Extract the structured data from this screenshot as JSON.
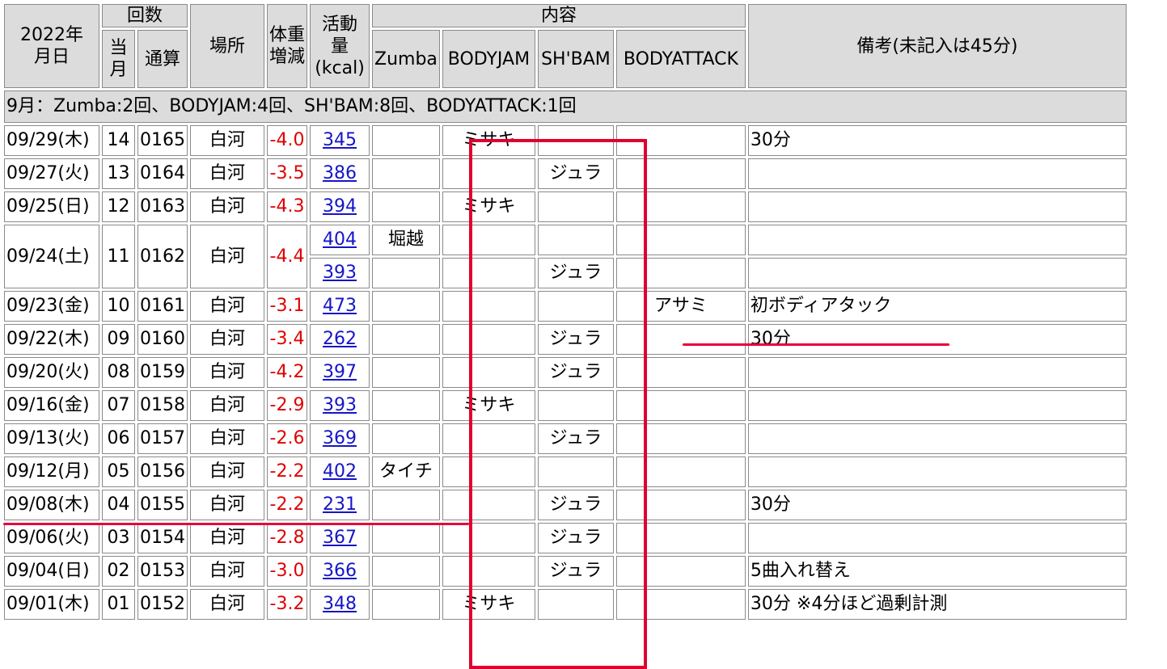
{
  "header": {
    "date_label": "2022年\n月日",
    "count_group": "回数",
    "count_month": "当\n月",
    "count_total": "通算",
    "place": "場所",
    "weight": "体重\n増減",
    "activity": "活動\n量\n(kcal)",
    "content_group": "内容",
    "programs": [
      "Zumba",
      "BODYJAM",
      "SH'BAM",
      "BODYATTACK"
    ],
    "notes": "備考(未記入は45分)"
  },
  "summary": "9月：Zumba:2回、BODYJAM:4回、SH'BAM:8回、BODYATTACK:1回",
  "rows": [
    {
      "date": "09/29(木)",
      "month": "14",
      "total": "0165",
      "place": "白河",
      "weight": "-4.0",
      "kcal": "345",
      "zumba": "",
      "bodyjam": "ミサキ",
      "shbam": "",
      "attack": "",
      "note": "30分"
    },
    {
      "date": "09/27(火)",
      "month": "13",
      "total": "0164",
      "place": "白河",
      "weight": "-3.5",
      "kcal": "386",
      "zumba": "",
      "bodyjam": "",
      "shbam": "ジュラ",
      "attack": "",
      "note": ""
    },
    {
      "date": "09/25(日)",
      "month": "12",
      "total": "0163",
      "place": "白河",
      "weight": "-4.3",
      "kcal": "394",
      "zumba": "",
      "bodyjam": "ミサキ",
      "shbam": "",
      "attack": "",
      "note": ""
    },
    {
      "date": "09/24(土)",
      "month": "11",
      "total": "0162",
      "place": "白河",
      "weight": "-4.4",
      "kcal": "404",
      "zumba": "堀越",
      "bodyjam": "",
      "shbam": "",
      "attack": "",
      "note": "",
      "kcal2": "393",
      "shbam2": "ジュラ"
    },
    {
      "date": "09/23(金)",
      "month": "10",
      "total": "0161",
      "place": "白河",
      "weight": "-3.1",
      "kcal": "473",
      "zumba": "",
      "bodyjam": "",
      "shbam": "",
      "attack": "アサミ",
      "note": "初ボディアタック"
    },
    {
      "date": "09/22(木)",
      "month": "09",
      "total": "0160",
      "place": "白河",
      "weight": "-3.4",
      "kcal": "262",
      "zumba": "",
      "bodyjam": "",
      "shbam": "ジュラ",
      "attack": "",
      "note": "30分"
    },
    {
      "date": "09/20(火)",
      "month": "08",
      "total": "0159",
      "place": "白河",
      "weight": "-4.2",
      "kcal": "397",
      "zumba": "",
      "bodyjam": "",
      "shbam": "ジュラ",
      "attack": "",
      "note": ""
    },
    {
      "date": "09/16(金)",
      "month": "07",
      "total": "0158",
      "place": "白河",
      "weight": "-2.9",
      "kcal": "393",
      "zumba": "",
      "bodyjam": "ミサキ",
      "shbam": "",
      "attack": "",
      "note": ""
    },
    {
      "date": "09/13(火)",
      "month": "06",
      "total": "0157",
      "place": "白河",
      "weight": "-2.6",
      "kcal": "369",
      "zumba": "",
      "bodyjam": "",
      "shbam": "ジュラ",
      "attack": "",
      "note": ""
    },
    {
      "date": "09/12(月)",
      "month": "05",
      "total": "0156",
      "place": "白河",
      "weight": "-2.2",
      "kcal": "402",
      "zumba": "タイチ",
      "bodyjam": "",
      "shbam": "",
      "attack": "",
      "note": ""
    },
    {
      "date": "09/08(木)",
      "month": "04",
      "total": "0155",
      "place": "白河",
      "weight": "-2.2",
      "kcal": "231",
      "zumba": "",
      "bodyjam": "",
      "shbam": "ジュラ",
      "attack": "",
      "note": "30分"
    },
    {
      "date": "09/06(火)",
      "month": "03",
      "total": "0154",
      "place": "白河",
      "weight": "-2.8",
      "kcal": "367",
      "zumba": "",
      "bodyjam": "",
      "shbam": "ジュラ",
      "attack": "",
      "note": ""
    },
    {
      "date": "09/04(日)",
      "month": "02",
      "total": "0153",
      "place": "白河",
      "weight": "-3.0",
      "kcal": "366",
      "zumba": "",
      "bodyjam": "",
      "shbam": "ジュラ",
      "attack": "",
      "note": "5曲入れ替え"
    },
    {
      "date": "09/01(木)",
      "month": "01",
      "total": "0152",
      "place": "白河",
      "weight": "-3.2",
      "kcal": "348",
      "zumba": "",
      "bodyjam": "ミサキ",
      "shbam": "",
      "attack": "",
      "note": "30分 ※4分ほど過剰計測"
    }
  ],
  "colors": {
    "negative": "#e00000",
    "link": "#1515c8",
    "highlight": "#e00030",
    "header_bg": "#dcdcdc"
  }
}
